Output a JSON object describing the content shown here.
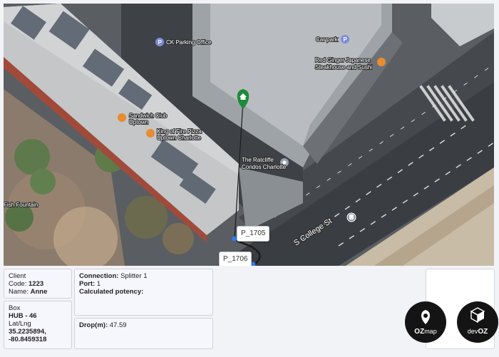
{
  "map": {
    "pois": {
      "ck_parking": "CK Parking Office",
      "car_park": "Car park",
      "red_ginger_1": "Red Ginger Japanese",
      "red_ginger_2": "Steakhouse and Sushi",
      "sandwich_1": "Sandwich Club",
      "sandwich_2": "Uptown",
      "king_1": "King of Fire Pizza",
      "king_2": "Uptown Charlotte",
      "ratcliffe_1": "The Ratcliffe",
      "ratcliffe_2": "Condos Charlotte",
      "fountain": "Fish Fountain"
    },
    "street": "S College St",
    "markers": {
      "p1705": "P_1705",
      "p1706": "P_1706"
    },
    "colors": {
      "route": "#1c1c1c",
      "node": "#2e7cf6",
      "home_pin": "#1f8a3a"
    }
  },
  "client": {
    "heading": "Client",
    "code_label": "Code:",
    "code_value": "1223",
    "name_label": "Name:",
    "name_value": "Anne"
  },
  "connection": {
    "connection_label": "Connection:",
    "connection_value": "Splitter 1",
    "port_label": "Port:",
    "port_value": "1",
    "potency_label": "Calculated potency:"
  },
  "box": {
    "heading": "Box",
    "hub": "HUB - 46",
    "latlng_label": "Lat/Lng",
    "lat": "35.2235894,",
    "lng": "-80.8459318"
  },
  "drop": {
    "label": "Drop(m):",
    "value": "47.59"
  },
  "logos": {
    "ozmap_prefix": "OZ",
    "ozmap_suffix": "map",
    "devoz_prefix": "dev",
    "devoz_suffix": "OZ"
  }
}
